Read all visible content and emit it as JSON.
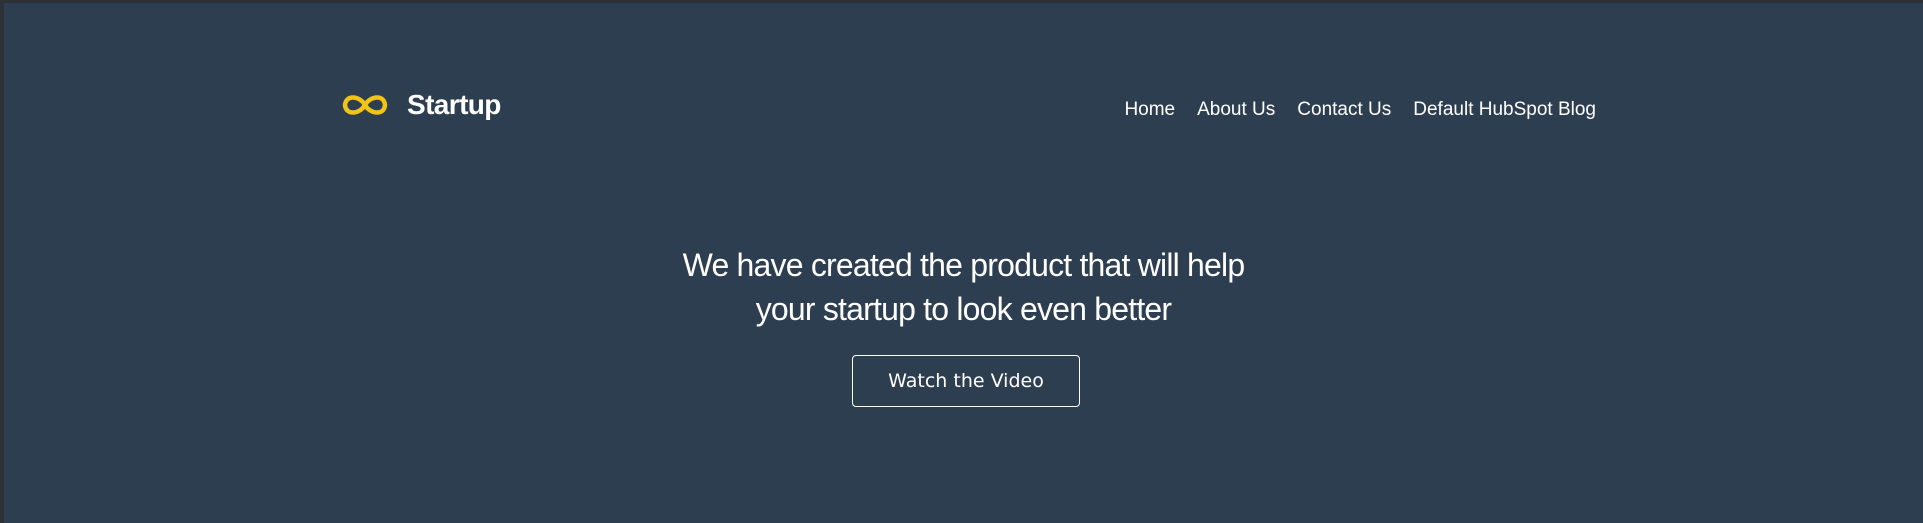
{
  "header": {
    "logo_text": "Startup",
    "logo_icon": "infinity-icon",
    "logo_icon_color": "#f2c417"
  },
  "nav": {
    "items": [
      {
        "label": "Home"
      },
      {
        "label": "About Us"
      },
      {
        "label": "Contact Us"
      },
      {
        "label": "Default HubSpot Blog"
      }
    ]
  },
  "hero": {
    "heading_line1": "We have created the product that will help",
    "heading_line2": "your startup to look even better",
    "button_label": "Watch the Video"
  },
  "colors": {
    "background": "#2e3e51",
    "accent": "#f2c417",
    "text": "#ffffff"
  }
}
